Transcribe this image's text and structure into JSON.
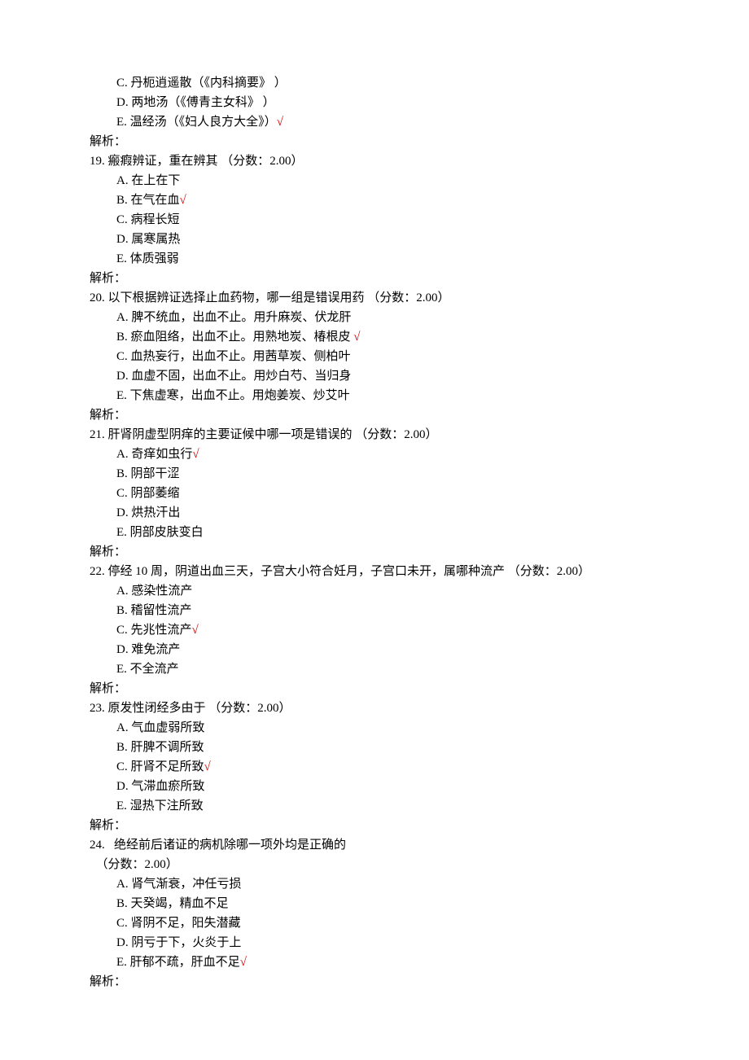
{
  "check_mark": "√",
  "analysis_label": "解析：",
  "preceding_options": [
    {
      "letter": "C",
      "text": "丹枙逍遥散（《内科摘要》 ）",
      "correct": false
    },
    {
      "letter": "D",
      "text": "两地汤（《傅青主女科》 ）",
      "correct": false
    },
    {
      "letter": "E",
      "text": "温经汤（《妇人良方大全》）",
      "correct": true
    }
  ],
  "questions": [
    {
      "number": "19",
      "stem": "瘢瘕辨证，重在辨其 （分数：2.00）",
      "options": [
        {
          "letter": "A",
          "text": "在上在下",
          "correct": false
        },
        {
          "letter": "B",
          "text": "在气在血",
          "correct": true
        },
        {
          "letter": "C",
          "text": "病程长短",
          "correct": false
        },
        {
          "letter": "D",
          "text": "属寒属热",
          "correct": false
        },
        {
          "letter": "E",
          "text": "体质强弱",
          "correct": false
        }
      ]
    },
    {
      "number": "20",
      "stem": "以下根据辨证选择止血药物，哪一组是错误用药 （分数：2.00）",
      "options": [
        {
          "letter": "A",
          "text": "脾不统血，出血不止。用升麻炭、伏龙肝",
          "correct": false
        },
        {
          "letter": "B",
          "text": "瘀血阻络，出血不止。用熟地炭、椿根皮 ",
          "correct": true
        },
        {
          "letter": "C",
          "text": "血热妄行，出血不止。用茜草炭、侧柏叶",
          "correct": false
        },
        {
          "letter": "D",
          "text": "血虚不固，出血不止。用炒白芍、当归身",
          "correct": false
        },
        {
          "letter": "E",
          "text": "下焦虚寒，出血不止。用炮姜炭、炒艾叶",
          "correct": false
        }
      ]
    },
    {
      "number": "21",
      "stem": "肝肾阴虚型阴痒的主要证候中哪一项是错误的 （分数：2.00）",
      "options": [
        {
          "letter": "A",
          "text": "奇痒如虫行",
          "correct": true
        },
        {
          "letter": "B",
          "text": "阴部干涩",
          "correct": false
        },
        {
          "letter": "C",
          "text": "阴部萎缩",
          "correct": false
        },
        {
          "letter": "D",
          "text": "烘热汗出",
          "correct": false
        },
        {
          "letter": "E",
          "text": "阴部皮肤变白",
          "correct": false
        }
      ]
    },
    {
      "number": "22",
      "stem": "停经 10 周，阴道出血三天，子宫大小符合妊月，子宫口未开，属哪种流产 （分数：2.00）",
      "options": [
        {
          "letter": "A",
          "text": "感染性流产",
          "correct": false
        },
        {
          "letter": "B",
          "text": "稽留性流产",
          "correct": false
        },
        {
          "letter": "C",
          "text": "先兆性流产",
          "correct": true
        },
        {
          "letter": "D",
          "text": "难免流产",
          "correct": false
        },
        {
          "letter": "E",
          "text": "不全流产",
          "correct": false
        }
      ]
    },
    {
      "number": "23",
      "stem": "原发性闭经多由于 （分数：2.00）",
      "options": [
        {
          "letter": "A",
          "text": "气血虚弱所致",
          "correct": false
        },
        {
          "letter": "B",
          "text": "肝脾不调所致",
          "correct": false
        },
        {
          "letter": "C",
          "text": "肝肾不足所致",
          "correct": true
        },
        {
          "letter": "D",
          "text": "气滞血瘀所致",
          "correct": false
        },
        {
          "letter": "E",
          "text": "湿热下注所致",
          "correct": false
        }
      ]
    },
    {
      "number": "24",
      "stem": "  绝经前后诸证的病机除哪一项外均是正确的",
      "score_line": "（分数：2.00）",
      "options": [
        {
          "letter": "A",
          "text": "肾气渐衰，冲任亏损",
          "correct": false
        },
        {
          "letter": "B",
          "text": "天癸竭，精血不足",
          "correct": false
        },
        {
          "letter": "C",
          "text": "肾阴不足，阳失潜藏",
          "correct": false
        },
        {
          "letter": "D",
          "text": "阴亏于下，火炎于上",
          "correct": false
        },
        {
          "letter": "E",
          "text": "肝郁不疏，肝血不足",
          "correct": true
        }
      ]
    }
  ]
}
